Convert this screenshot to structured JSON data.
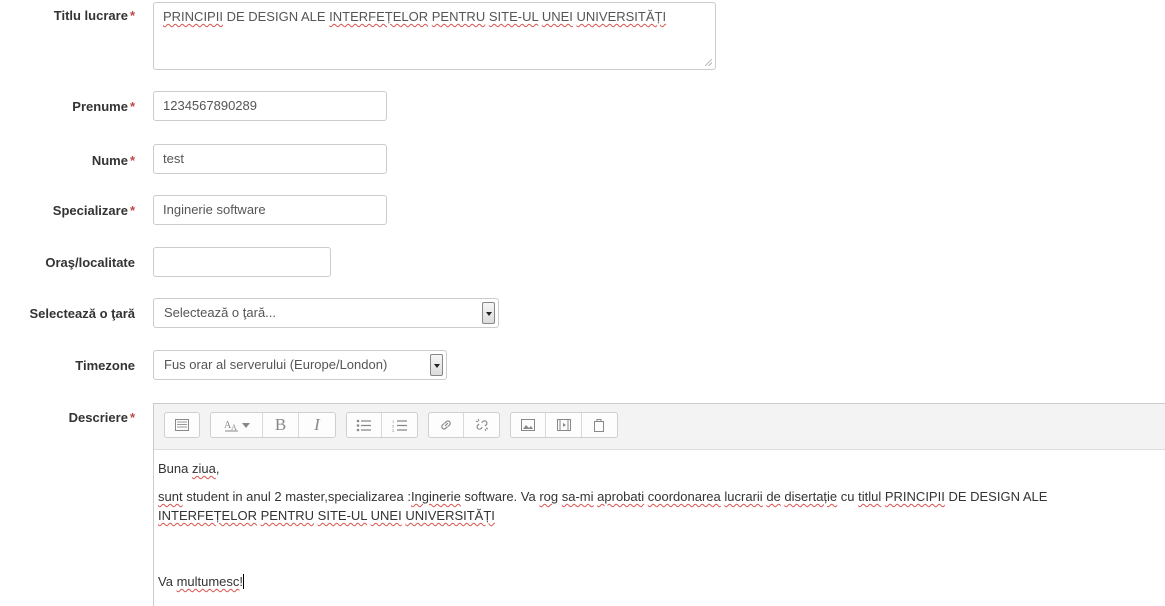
{
  "form": {
    "title_label": "Titlu lucrare",
    "title_value_parts": [
      "PRINCIPII",
      " DE DESIGN ALE ",
      "INTERFEȚELOR",
      " ",
      "PENTRU",
      " ",
      "SITE-UL",
      " ",
      "UNEI",
      " ",
      "UNIVERSITĂȚI"
    ],
    "firstname_label": "Prenume",
    "firstname_value": "1234567890289",
    "lastname_label": "Nume",
    "lastname_value": "test",
    "specialization_label": "Specializare",
    "specialization_value": "Inginerie software",
    "city_label": "Oraş/localitate",
    "city_value": "",
    "country_label": "Selectează o ţară",
    "country_selected": "Selectează o ţară...",
    "timezone_label": "Timezone",
    "timezone_selected": "Fus orar al serverului (Europe/London)",
    "description_label": "Descriere",
    "required_marker": "*"
  },
  "editor": {
    "toolbar_icons": [
      "toolbar-toggle-icon",
      "font-style-icon",
      "bold-icon",
      "italic-icon",
      "unordered-list-icon",
      "ordered-list-icon",
      "link-icon",
      "unlink-icon",
      "image-icon",
      "media-icon",
      "manage-files-icon"
    ],
    "bold_glyph": "B",
    "italic_glyph": "I",
    "greeting_word": "Buna",
    "greeting_misspelled": "ziua",
    "greeting_tail": ",",
    "line2_a": "sunt",
    "line2_b": " student in anul 2 master,specializarea :",
    "line2_c": "Inginerie",
    "line2_d": " software. Va ",
    "line2_e": "rog",
    "line2_f": " ",
    "line2_g": "sa-mi",
    "line2_h": " ",
    "line2_i": "aprobati",
    "line2_j": " ",
    "line2_k": "coordonarea",
    "line2_l": " ",
    "line2_m": "lucrarii",
    "line2_n": " ",
    "line2_o": "de",
    "line2_p": " ",
    "line2_q": "disertație",
    "line2_r": " cu ",
    "line2_s": "titlul",
    "line2_t": " ",
    "line2_u": "PRINCIPII",
    "line2_v": " DE DESIGN ALE",
    "line3_a": "INTERFEȚELOR",
    "line3_b": " ",
    "line3_c": "PENTRU",
    "line3_d": " ",
    "line3_e": "SITE-UL",
    "line3_f": " ",
    "line3_g": "UNEI",
    "line3_h": " ",
    "line3_i": "UNIVERSITĂȚI",
    "closing_a": "Va ",
    "closing_b": "multumesc",
    "closing_c": "!"
  }
}
